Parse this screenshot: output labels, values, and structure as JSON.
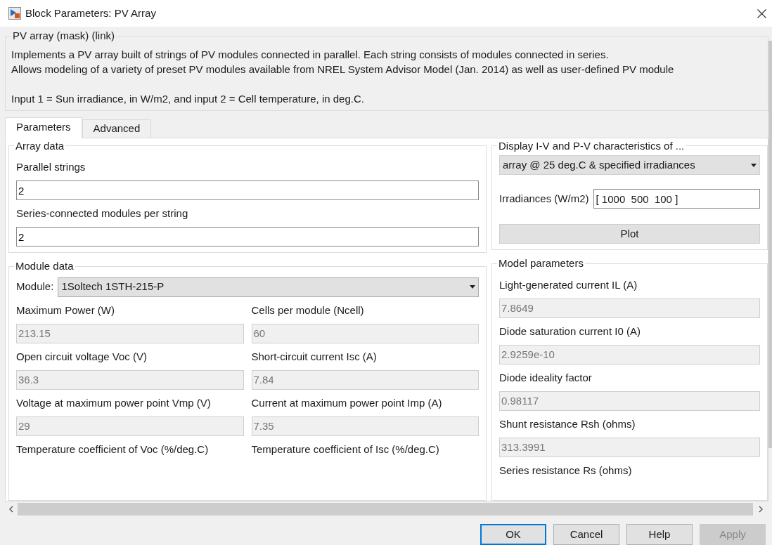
{
  "window": {
    "title": "Block Parameters: PV Array"
  },
  "mask": {
    "title": "PV array (mask) (link)",
    "description": [
      "Implements a PV array built of strings of PV modules connected in parallel. Each string consists of modules connected in series.",
      "Allows modeling of a variety of preset PV modules available from NREL System Advisor Model (Jan. 2014) as well as user-defined PV module"
    ],
    "note": "Input 1 = Sun irradiance, in W/m2, and input 2 = Cell temperature, in deg.C."
  },
  "tabs": [
    {
      "label": "Parameters",
      "selected": true
    },
    {
      "label": "Advanced",
      "selected": false
    }
  ],
  "array_data": {
    "title": "Array data",
    "fields": [
      {
        "label": "Parallel strings",
        "value": "2",
        "disabled": false
      },
      {
        "label": "Series-connected modules per string",
        "value": "2",
        "disabled": false
      }
    ]
  },
  "module_data": {
    "title": "Module data",
    "module": {
      "label": "Module:",
      "value": "1Soltech 1STH-215-P"
    },
    "params": [
      {
        "label": "Maximum Power (W)",
        "value": "213.15",
        "disabled": true
      },
      {
        "label": "Cells per module (Ncell)",
        "value": "60",
        "disabled": true
      },
      {
        "label": "Open circuit voltage  Voc (V)",
        "value": "36.3",
        "disabled": true
      },
      {
        "label": "Short-circuit current Isc (A)",
        "value": "7.84",
        "disabled": true
      },
      {
        "label": "Voltage at maximum power point Vmp (V)",
        "value": "29",
        "disabled": true
      },
      {
        "label": "Current at maximum power point Imp (A)",
        "value": "7.35",
        "disabled": true
      },
      {
        "label": "Temperature coefficient of Voc (%/deg.C)"
      },
      {
        "label": "Temperature coefficient of Isc (%/deg.C)"
      }
    ]
  },
  "display": {
    "title": "Display  I-V and P-V characteristics of ...",
    "select": "array @ 25 deg.C & specified irradiances",
    "irradiances": {
      "label": "Irradiances (W/m2)",
      "value": "[ 1000  500  100 ]"
    },
    "button": "Plot"
  },
  "model_parameters": {
    "title": "Model parameters",
    "fields": [
      {
        "label": "Light-generated current IL (A)",
        "value": "7.8649",
        "disabled": true
      },
      {
        "label": "Diode saturation current I0 (A)",
        "value": "2.9259e-10",
        "disabled": true
      },
      {
        "label": "Diode ideality factor",
        "value": "0.98117",
        "disabled": true
      },
      {
        "label": "Shunt resistance Rsh (ohms)",
        "value": "313.3991",
        "disabled": true
      },
      {
        "label": "Series resistance Rs (ohms)"
      }
    ]
  },
  "buttons": [
    {
      "label": "OK",
      "default": true,
      "disabled": false
    },
    {
      "label": "Cancel",
      "default": false,
      "disabled": false
    },
    {
      "label": "Help",
      "default": false,
      "disabled": false
    },
    {
      "label": "Apply",
      "default": false,
      "disabled": true
    }
  ]
}
